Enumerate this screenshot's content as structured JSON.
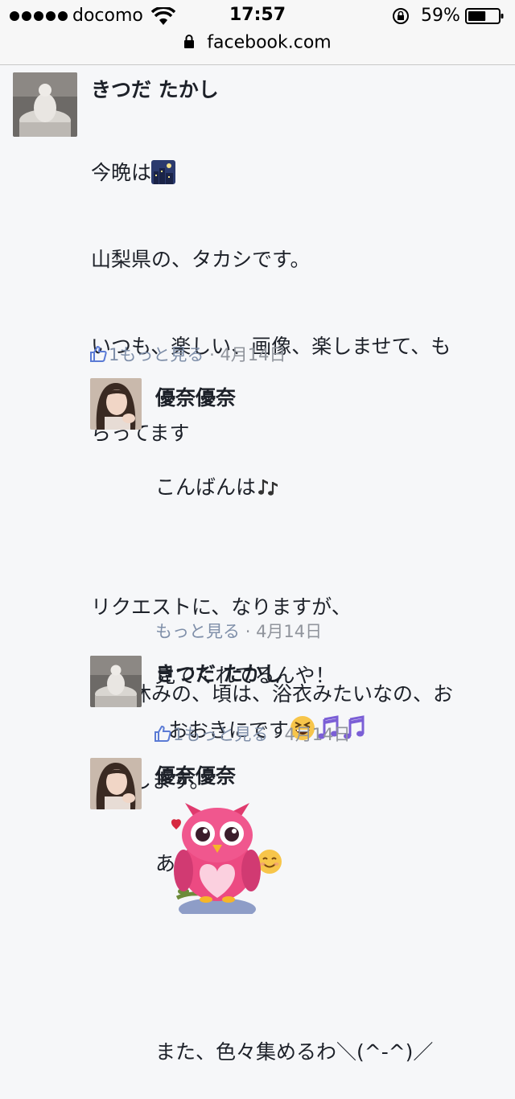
{
  "status_bar": {
    "carrier": "docomo",
    "time": "17:57",
    "battery": "59%",
    "battery_level": 0.59,
    "signal_bars": 5
  },
  "url_bar": {
    "host": "facebook.com"
  },
  "comments": [
    {
      "author": "きつだ たかし",
      "text_before_emoji": "今晩は",
      "emoji": "night-city-icon",
      "lines": [
        "山梨県の、タカシです。",
        "いつも、楽しい、画像、楽しませて、も",
        "らってます",
        "",
        "リクエストに、なりますが、",
        "お盆休みの、頃は、浴衣みたいなの、お",
        "願いします。"
      ],
      "likes": "1",
      "more": "もっと見る",
      "separator": "·",
      "date": "4月14日"
    },
    {
      "author": "優奈優奈",
      "line1": "こんばんは",
      "line2": "見てくれてるんや！",
      "line3": "ありがとう",
      "line4": "また、色々集めるわ＼(^-^)／",
      "more": "もっと見る",
      "separator": "·",
      "date": "4月14日"
    },
    {
      "author": "きつだ たかし",
      "text": "おおきにです",
      "likes": "1",
      "more": "もっと見る",
      "separator": "·",
      "date": "4月14日"
    },
    {
      "author": "優奈優奈",
      "sticker": "owl-heart-sticker"
    }
  ],
  "colors": {
    "background": "#f6f7f9",
    "text": "#1d2129",
    "meta": "#90949c",
    "link_blue": "#7f8fa9",
    "like_blue": "#5b7bd5"
  }
}
